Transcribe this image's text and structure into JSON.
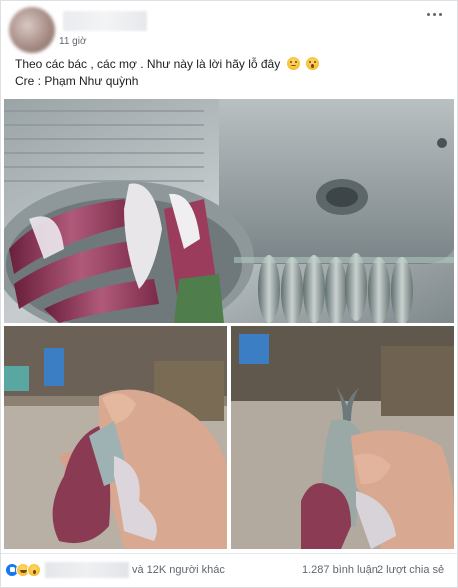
{
  "post": {
    "time": "11 giờ",
    "text_line1": "Theo các bác , các mợ . Như này là lời hãy lỗ đây",
    "text_line2": "Cre : Phạm Như quỳnh",
    "emoji_1": "disappointed-face",
    "emoji_2": "surprised-face"
  },
  "photos": {
    "main_subject": "fish and squid on tray next to sink",
    "left_subject": "hand holding squid with fish inside",
    "right_subject": "hand holding squid with fish tail out"
  },
  "footer": {
    "reactions": [
      "like",
      "haha",
      "wow"
    ],
    "others": "và 12K người khác",
    "comments": "1.287 bình luận",
    "shares": "2 lượt chia sẻ"
  },
  "colors": {
    "accent": "#1877f2",
    "text": "#1c1e21",
    "muted": "#606770"
  }
}
